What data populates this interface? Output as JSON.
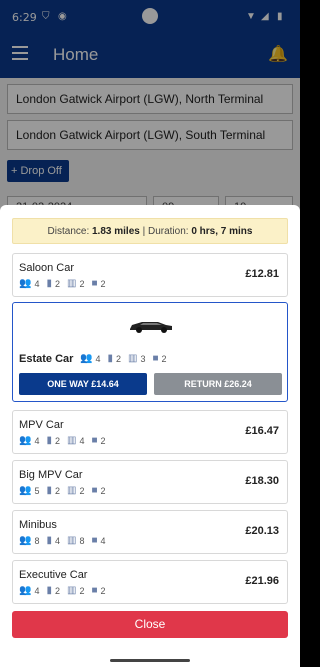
{
  "status": {
    "time": "6:29"
  },
  "appbar": {
    "title": "Home"
  },
  "page": {
    "pickup": "London Gatwick Airport (LGW), North Terminal",
    "dropoff": "London Gatwick Airport (LGW), South Terminal",
    "dropoff_button": "+ Drop Off",
    "date_stubs": [
      "21-02-2024",
      "09",
      "10"
    ]
  },
  "sheet": {
    "distance_label": "Distance:",
    "distance_value": "1.83 miles",
    "duration_label": "| Duration:",
    "duration_value": "0 hrs, 7 mins",
    "vehicles": [
      {
        "name": "Saloon Car",
        "passengers": "4",
        "luggage": "2",
        "hand_luggage": "2",
        "briefcase": "2",
        "price": "£12.81"
      },
      {
        "name": "MPV Car",
        "passengers": "4",
        "luggage": "2",
        "hand_luggage": "4",
        "briefcase": "2",
        "price": "£16.47"
      },
      {
        "name": "Big MPV Car",
        "passengers": "5",
        "luggage": "2",
        "hand_luggage": "2",
        "briefcase": "2",
        "price": "£18.30"
      },
      {
        "name": "Minibus",
        "passengers": "8",
        "luggage": "4",
        "hand_luggage": "8",
        "briefcase": "4",
        "price": "£20.13"
      },
      {
        "name": "Executive Car",
        "passengers": "4",
        "luggage": "2",
        "hand_luggage": "2",
        "briefcase": "2",
        "price": "£21.96"
      }
    ],
    "selected": {
      "name": "Estate Car",
      "passengers": "4",
      "luggage": "2",
      "hand_luggage": "3",
      "briefcase": "2",
      "one_way": "ONE WAY £14.64",
      "return": "RETURN £26.24"
    },
    "close": "Close"
  },
  "colors": {
    "primary": "#0a3a8c",
    "close": "#e0374a",
    "info_bg": "#fbf1c8",
    "selected_border": "#2456c9"
  },
  "icons": {
    "passengers": "people-icon",
    "luggage": "suitcase-icon",
    "hand_luggage": "hand-luggage-icon",
    "briefcase": "briefcase-icon"
  }
}
